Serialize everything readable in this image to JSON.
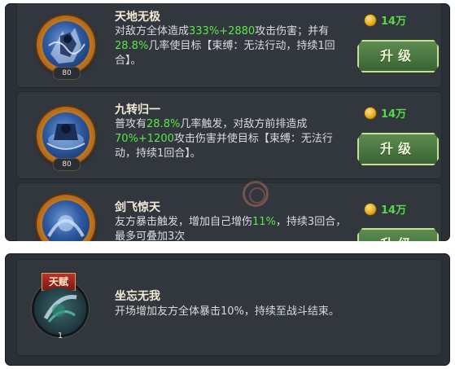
{
  "skills": [
    {
      "name": "天地无极",
      "level": "80",
      "desc_parts": [
        "对敌方全体造成",
        "333%+2880",
        "攻击伤害；并有",
        "28.8%",
        "几率使目标【束缚：无法行动，持续1回合】。"
      ],
      "cost": "14万",
      "button": "升级",
      "icon": "warrior-skill-icon"
    },
    {
      "name": "九转归一",
      "level": "80",
      "desc_parts": [
        "普攻有",
        "28.8%",
        "几率触发，对敌方前排造成",
        "70%+1200",
        "攻击伤害并使目标【束缚：无法行动，持续1回合】。"
      ],
      "cost": "14万",
      "button": "升级",
      "icon": "whirl-skill-icon"
    },
    {
      "name": "剑飞惊天",
      "level": "",
      "desc_parts": [
        "友方暴击触发，增加自己增伤",
        "11%",
        "，持续3回合，最多可叠加3次"
      ],
      "cost": "14万",
      "button": "升级",
      "icon": "sword-skill-icon"
    }
  ],
  "talent": {
    "badge": "天赋",
    "name": "坐忘无我",
    "level": "1",
    "desc": "开场增加友方全体暴击10%，持续至战斗结束。",
    "icon": "talent-skill-icon"
  },
  "colors": {
    "panel": "#2b3036",
    "highlight": "#5ce64a",
    "cost_text": "#57d84a",
    "button": "#4a7740",
    "badge_red": "#9b2620"
  }
}
